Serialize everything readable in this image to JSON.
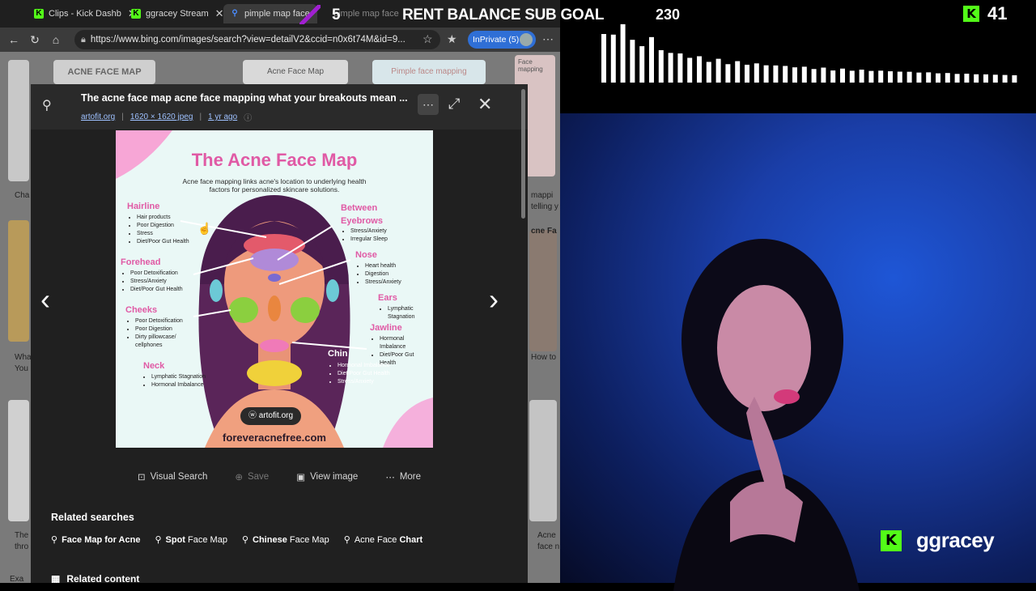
{
  "browser": {
    "tabs": [
      {
        "label": "Clips - Kick Dashb",
        "fav": "K",
        "fav_color": "#53fc18"
      },
      {
        "label": "ggracey Stream",
        "fav": "K",
        "fav_color": "#53fc18"
      },
      {
        "label": "pimple map face",
        "fav": "🔍",
        "fav_color": "#4a8cff"
      },
      {
        "label": "pimple map face",
        "fav": "",
        "fav_color": "#2b2b2b"
      }
    ],
    "url": "https://www.bing.com/images/search?view=detailV2&ccid=n0x6t74M&id=9...",
    "inprivate": "InPrivate (5)"
  },
  "bg_labels": {
    "left_header": "ACNE FACE MAP",
    "mid_header": "Acne Face Map",
    "right_text": "Pimple face mapping",
    "right_text2": "Face mapping",
    "left_snip1": "Cha",
    "left_snip2": "Wha",
    "left_snip3": "You",
    "left_snip4": "The",
    "left_snip5": "thro",
    "left_snip6": "Exa",
    "right_snip1": "mappi",
    "right_snip2": "telling y",
    "right_snip3": "cne Fa",
    "right_snip4": "How to",
    "right_snip5": "Acne",
    "right_snip6": "face n"
  },
  "viewer": {
    "title": "The acne face map acne face mapping what your breakouts mean ...",
    "source": "artofit.org",
    "dims": "1620 × 1620 jpeg",
    "age": "1 yr ago",
    "image": {
      "title": "The Acne Face Map",
      "subtitle": "Acne face mapping links acne's location to underlying health factors for personalized skincare solutions.",
      "hairline_h": "Hairline",
      "hairline": [
        "Hair products",
        "Poor Digestion",
        "Stress",
        "Diet/Poor Gut Health"
      ],
      "between_h": "Between Eyebrows",
      "between": [
        "Stress/Anxiety",
        "Irregular Sleep"
      ],
      "forehead_h": "Forehead",
      "forehead": [
        "Poor Detoxification",
        "Stress/Anxiety",
        "Diet/Poor Gut Health"
      ],
      "nose_h": "Nose",
      "nose": [
        "Heart health",
        "Digestion",
        "Stress/Anxiety"
      ],
      "ears_h": "Ears",
      "ears": [
        "Lymphatic Stagnation"
      ],
      "cheeks_h": "Cheeks",
      "cheeks": [
        "Poor Detoxification",
        "Poor Digestion",
        "Dirty pillowcase/ cellphones"
      ],
      "jawline_h": "Jawline",
      "jawline": [
        "Hormonal Imbalance",
        "Diet/Poor Gut Health"
      ],
      "neck_h": "Neck",
      "neck": [
        "Lymphatic Stagnation",
        "Hormonal Imbalance"
      ],
      "chin_h": "Chin",
      "chin": [
        "Hormonal Imbalance",
        "Diet/Poor Gut Health",
        "Stress/Anxiety"
      ],
      "badge": "artofit.org",
      "footer": "foreveracnefree.com"
    },
    "actions": {
      "visual": "Visual Search",
      "save": "Save",
      "view": "View image",
      "more": "More"
    },
    "related_h": "Related searches",
    "related": [
      {
        "pre": "Face Map for Acne",
        "b": ""
      },
      {
        "pre": "",
        "b": "Spot",
        "post": " Face Map"
      },
      {
        "pre": "",
        "b": "Chinese",
        "post": " Face Map"
      },
      {
        "pre": "Acne Face ",
        "b": "Chart"
      }
    ],
    "related_content": "Related content"
  },
  "stream": {
    "goal_prefix": "5",
    "goal_text": "RENT BALANCE SUB GOAL",
    "goal_count": "230",
    "viewers": "41",
    "handle": "ggracey",
    "accent": "#53fc18"
  }
}
